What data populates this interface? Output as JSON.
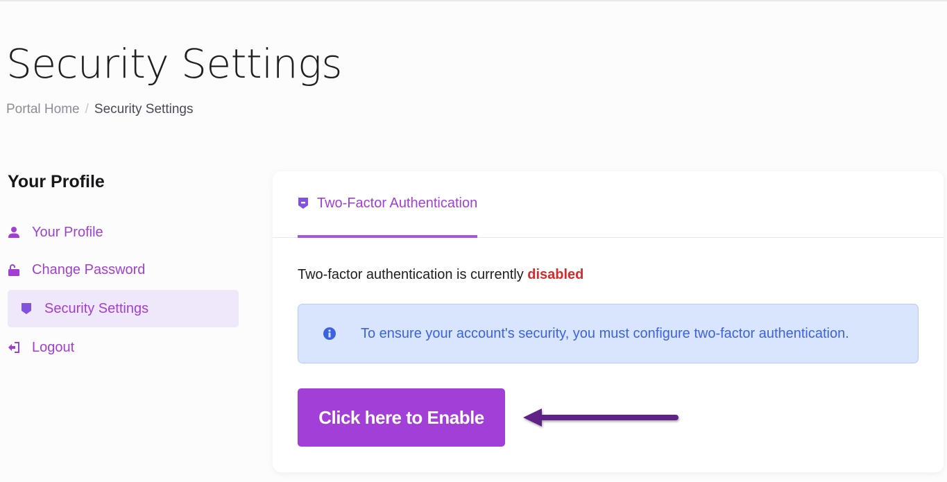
{
  "header": {
    "title": "Security Settings",
    "breadcrumb": [
      {
        "label": "Portal Home"
      },
      {
        "label": "Security Settings"
      }
    ],
    "breadcrumb_separator": "/"
  },
  "sidebar": {
    "title": "Your Profile",
    "items": [
      {
        "label": "Your Profile",
        "icon": "user-icon",
        "active": false
      },
      {
        "label": "Change Password",
        "icon": "unlock-icon",
        "active": false
      },
      {
        "label": "Security Settings",
        "icon": "shield-icon",
        "active": true
      },
      {
        "label": "Logout",
        "icon": "logout-icon",
        "active": false
      }
    ]
  },
  "main": {
    "tabs": [
      {
        "label": "Two-Factor Authentication",
        "icon": "shield-icon",
        "active": true
      }
    ],
    "status_prefix": "Two-factor authentication is currently",
    "status_value": "disabled",
    "alert": {
      "icon": "info-icon",
      "text": "To ensure your account's security, you must configure two-factor authentication."
    },
    "enable_button_label": "Click here to Enable",
    "annotation": "arrow-pointing-left"
  },
  "colors": {
    "accent": "#a13fd6",
    "status_disabled": "#d42a2a",
    "alert_bg": "#d9e4fd",
    "alert_text": "#3b63e0",
    "arrow": "#5f2185"
  }
}
